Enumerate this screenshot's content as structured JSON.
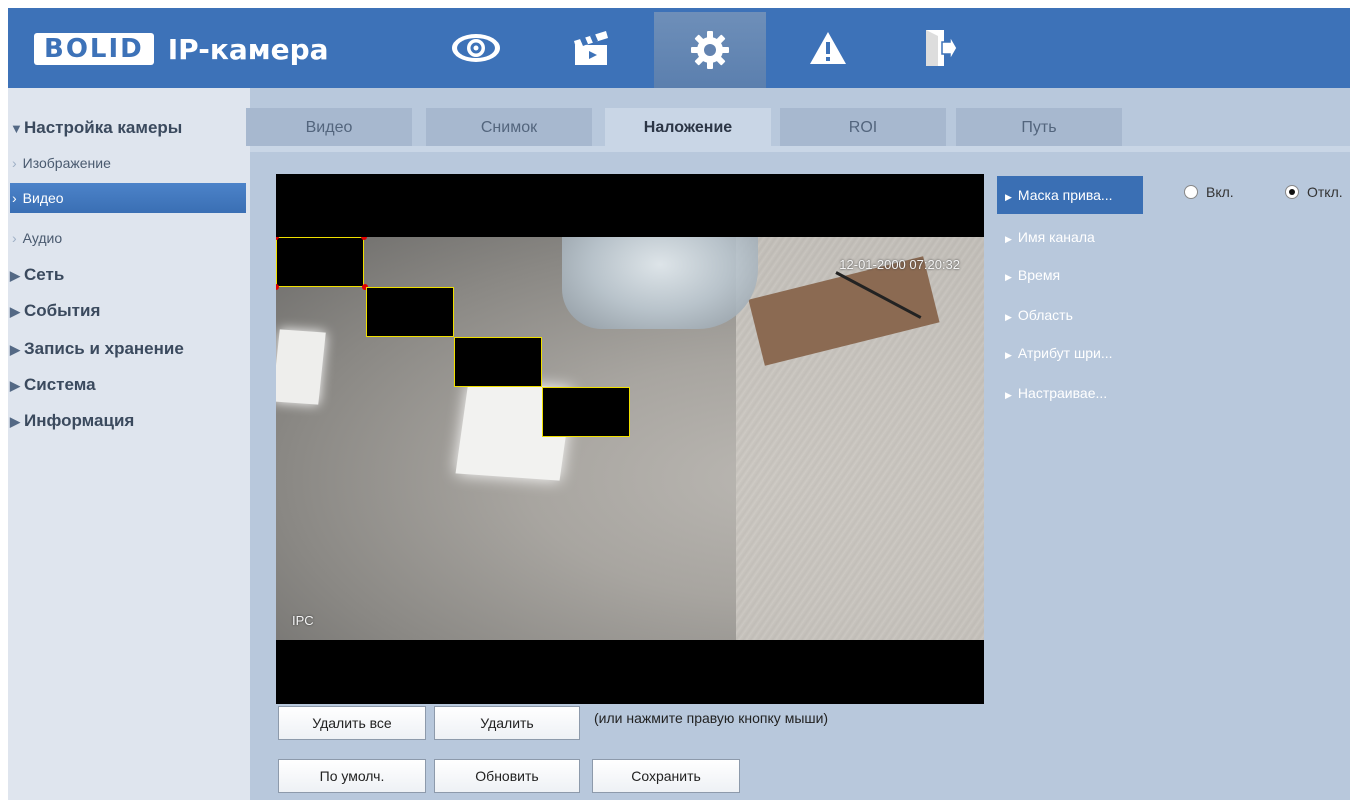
{
  "header": {
    "logo_text": "BOLID",
    "app_title": "IP-камера",
    "nav_icons": [
      "eye-icon",
      "clapperboard-icon",
      "gear-icon",
      "warning-icon",
      "logout-icon"
    ],
    "active_nav": "gear-icon"
  },
  "sidebar": {
    "items": [
      {
        "label": "Настройка камеры",
        "level": "top",
        "expanded": true
      },
      {
        "label": "Изображение",
        "level": "sub"
      },
      {
        "label": "Видео",
        "level": "sub",
        "active": true
      },
      {
        "label": "Аудио",
        "level": "sub"
      },
      {
        "label": "Сеть",
        "level": "top"
      },
      {
        "label": "События",
        "level": "top"
      },
      {
        "label": "Запись и хранение",
        "level": "top"
      },
      {
        "label": "Система",
        "level": "top"
      },
      {
        "label": "Информация",
        "level": "top"
      }
    ]
  },
  "tabs": [
    {
      "label": "Видео"
    },
    {
      "label": "Снимок"
    },
    {
      "label": "Наложение",
      "active": true
    },
    {
      "label": "ROI"
    },
    {
      "label": "Путь"
    }
  ],
  "video": {
    "timestamp": "12-01-2000 07:20:32",
    "channel_name": "IPC"
  },
  "overlay_menu": [
    {
      "label": "Маска прива...",
      "active": true
    },
    {
      "label": "Имя канала"
    },
    {
      "label": "Время"
    },
    {
      "label": "Область"
    },
    {
      "label": "Атрибут шри..."
    },
    {
      "label": "Настраивае..."
    }
  ],
  "privacy_mask": {
    "on_label": "Вкл.",
    "off_label": "Откл.",
    "selected": "off"
  },
  "buttons": {
    "delete_all": "Удалить все",
    "delete": "Удалить",
    "hint": "(или нажмите правую кнопку мыши)",
    "default": "По умолч.",
    "refresh": "Обновить",
    "save": "Сохранить"
  },
  "colors": {
    "header_bg": "#3d72b8",
    "accent": "#3a6fb4",
    "mask_border": "#f0e000"
  }
}
